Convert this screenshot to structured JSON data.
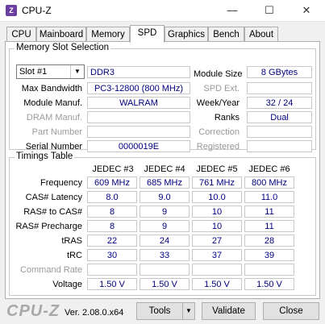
{
  "window": {
    "title": "CPU-Z",
    "icon_text": "Z",
    "minimize_glyph": "—",
    "maximize_glyph": "☐",
    "close_glyph": "✕"
  },
  "tabs": [
    {
      "label": "CPU"
    },
    {
      "label": "Mainboard"
    },
    {
      "label": "Memory"
    },
    {
      "label": "SPD"
    },
    {
      "label": "Graphics"
    },
    {
      "label": "Bench"
    },
    {
      "label": "About"
    }
  ],
  "active_tab": "SPD",
  "memory_slot": {
    "group_title": "Memory Slot Selection",
    "slot_selected": "Slot #1",
    "type": "DDR3",
    "max_bandwidth_label": "Max Bandwidth",
    "max_bandwidth": "PC3-12800 (800 MHz)",
    "module_manuf_label": "Module Manuf.",
    "module_manuf": "WALRAM",
    "dram_manuf_label": "DRAM Manuf.",
    "part_number_label": "Part Number",
    "serial_number_label": "Serial Number",
    "serial_number": "0000019E",
    "module_size_label": "Module Size",
    "module_size": "8 GBytes",
    "spd_ext_label": "SPD Ext.",
    "week_year_label": "Week/Year",
    "week_year": "32 / 24",
    "ranks_label": "Ranks",
    "ranks": "Dual",
    "correction_label": "Correction",
    "registered_label": "Registered"
  },
  "timings": {
    "group_title": "Timings Table",
    "columns": [
      "JEDEC #3",
      "JEDEC #4",
      "JEDEC #5",
      "JEDEC #6"
    ],
    "rows": [
      {
        "label": "Frequency",
        "disabled": false,
        "values": [
          "609 MHz",
          "685 MHz",
          "761 MHz",
          "800 MHz"
        ]
      },
      {
        "label": "CAS# Latency",
        "disabled": false,
        "values": [
          "8.0",
          "9.0",
          "10.0",
          "11.0"
        ]
      },
      {
        "label": "RAS# to CAS#",
        "disabled": false,
        "values": [
          "8",
          "9",
          "10",
          "11"
        ]
      },
      {
        "label": "RAS# Precharge",
        "disabled": false,
        "values": [
          "8",
          "9",
          "10",
          "11"
        ]
      },
      {
        "label": "tRAS",
        "disabled": false,
        "values": [
          "22",
          "24",
          "27",
          "28"
        ]
      },
      {
        "label": "tRC",
        "disabled": false,
        "values": [
          "30",
          "33",
          "37",
          "39"
        ]
      },
      {
        "label": "Command Rate",
        "disabled": true,
        "values": [
          "",
          "",
          "",
          ""
        ]
      },
      {
        "label": "Voltage",
        "disabled": false,
        "values": [
          "1.50 V",
          "1.50 V",
          "1.50 V",
          "1.50 V"
        ]
      }
    ]
  },
  "footer": {
    "brand": "CPU-Z",
    "version": "Ver. 2.08.0.x64",
    "tools_label": "Tools",
    "validate_label": "Validate",
    "close_label": "Close"
  },
  "colors": {
    "value_text": "#000080",
    "disabled_text": "#9a9a9a"
  }
}
